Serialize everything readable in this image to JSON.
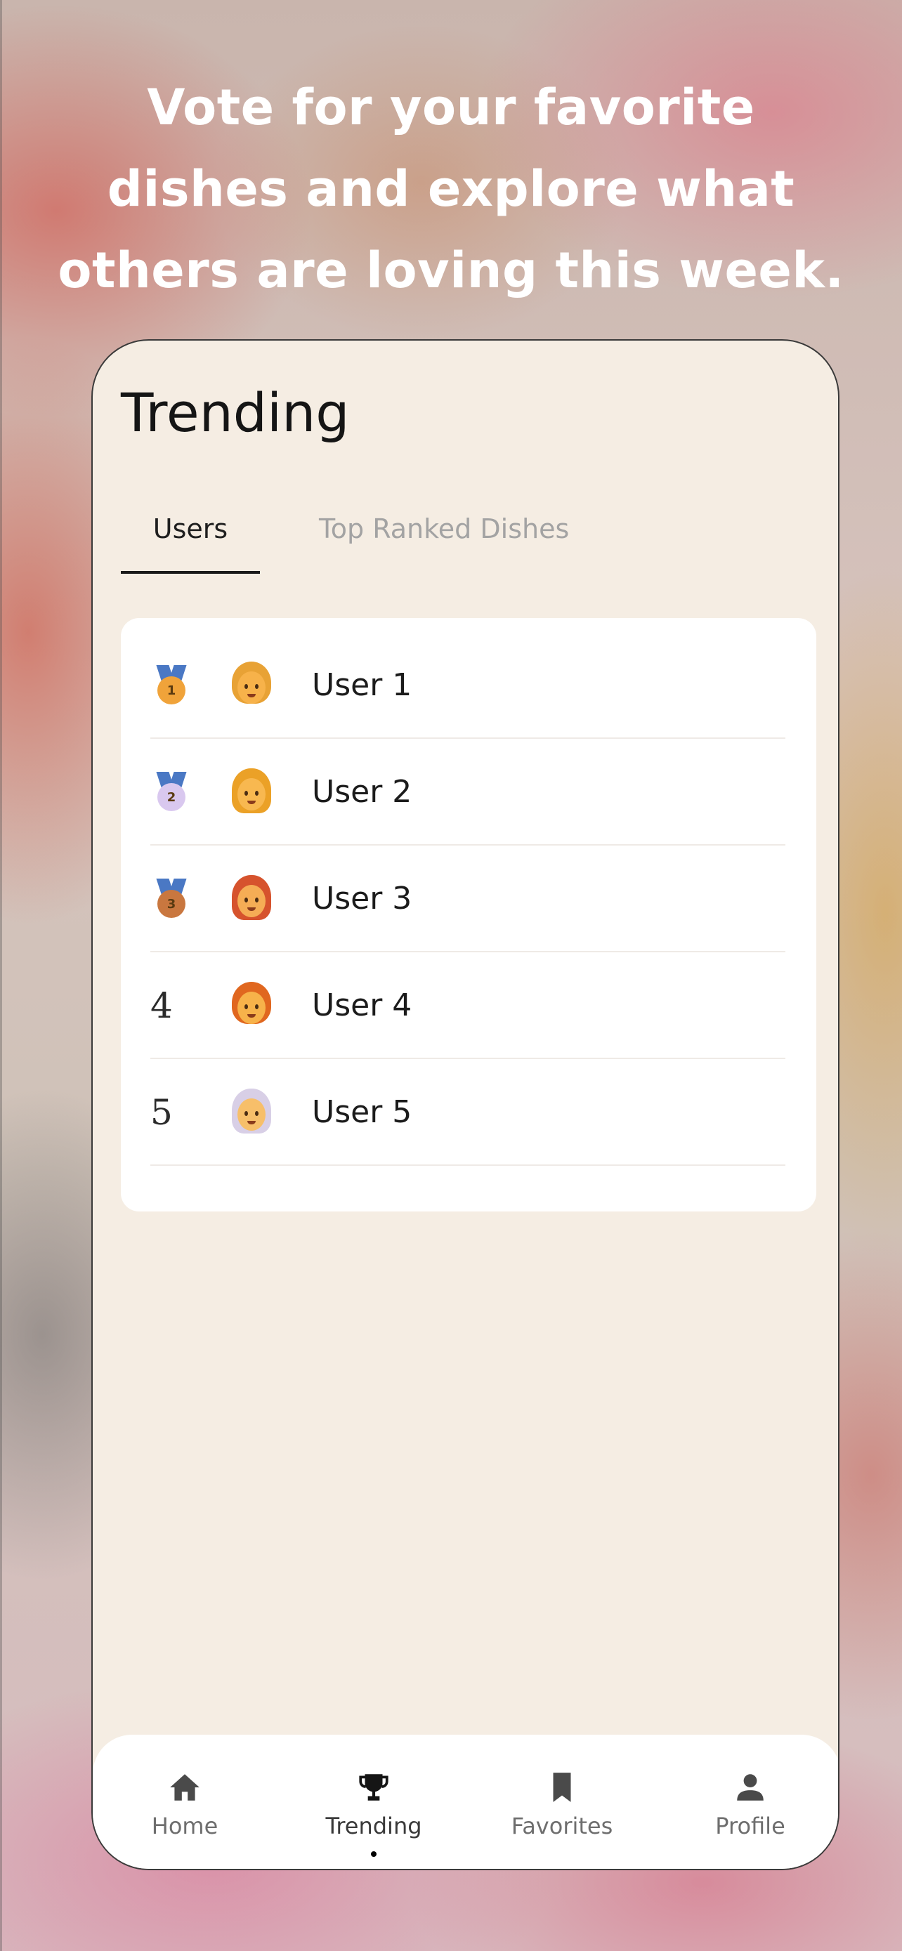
{
  "promo": {
    "headline": "Vote for your favorite\ndishes and explore what\nothers are loving this week."
  },
  "screen": {
    "title": "Trending",
    "tabs": [
      {
        "label": "Users",
        "active": true
      },
      {
        "label": "Top Ranked Dishes",
        "active": false
      }
    ],
    "leaderboard": [
      {
        "rank": "1",
        "medal": "gold-medal-icon",
        "avatar": "person-blond-icon",
        "name": "User 1"
      },
      {
        "rank": "2",
        "medal": "silver-medal-icon",
        "avatar": "woman-blond-icon",
        "name": "User 2"
      },
      {
        "rank": "3",
        "medal": "bronze-medal-icon",
        "avatar": "woman-red-hair-icon",
        "name": "User 3"
      },
      {
        "rank": "4",
        "medal": null,
        "avatar": "man-red-hair-icon",
        "name": "User 4"
      },
      {
        "rank": "5",
        "medal": null,
        "avatar": "old-woman-icon",
        "name": "User 5"
      }
    ]
  },
  "nav": {
    "items": [
      {
        "label": "Home",
        "icon": "home-icon",
        "active": false
      },
      {
        "label": "Trending",
        "icon": "trophy-icon",
        "active": true
      },
      {
        "label": "Favorites",
        "icon": "bookmark-icon",
        "active": false
      },
      {
        "label": "Profile",
        "icon": "person-icon",
        "active": false
      }
    ]
  },
  "colors": {
    "screen_bg": "#f5ede3",
    "card_bg": "#ffffff",
    "tab_active": "#1f1f1f",
    "tab_inactive": "#a3a3a3",
    "medal_gold": "#f0a33a",
    "medal_silver": "#d9c8ef",
    "medal_bronze": "#c9773f",
    "ribbon": "#4a78c4"
  }
}
